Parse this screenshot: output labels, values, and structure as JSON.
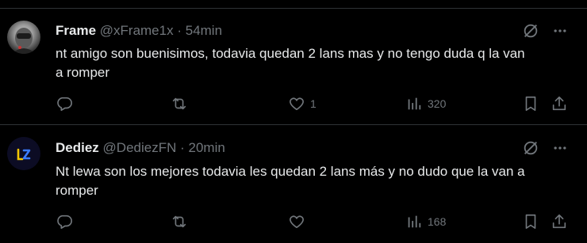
{
  "tweets": [
    {
      "name": "Frame",
      "handle": "@xFrame1x",
      "sep": "·",
      "time": "54min",
      "text": "nt amigo son buenisimos, todavia quedan 2 lans mas y no tengo duda q la van a romper",
      "replies": "",
      "retweets": "",
      "likes": "1",
      "views": "320"
    },
    {
      "name": "Dediez",
      "handle": "@DediezFN",
      "sep": "·",
      "time": "20min",
      "text": "Nt lewa son los mejores todavia les quedan 2 lans más y no dudo que la van a romper",
      "replies": "",
      "retweets": "",
      "likes": "",
      "views": "168"
    }
  ],
  "icons": {
    "topic": "hide-reply-icon",
    "more": "more-icon",
    "reply": "reply-icon",
    "retweet": "retweet-icon",
    "like": "heart-icon",
    "views": "views-icon",
    "bookmark": "bookmark-icon",
    "share": "share-icon"
  }
}
